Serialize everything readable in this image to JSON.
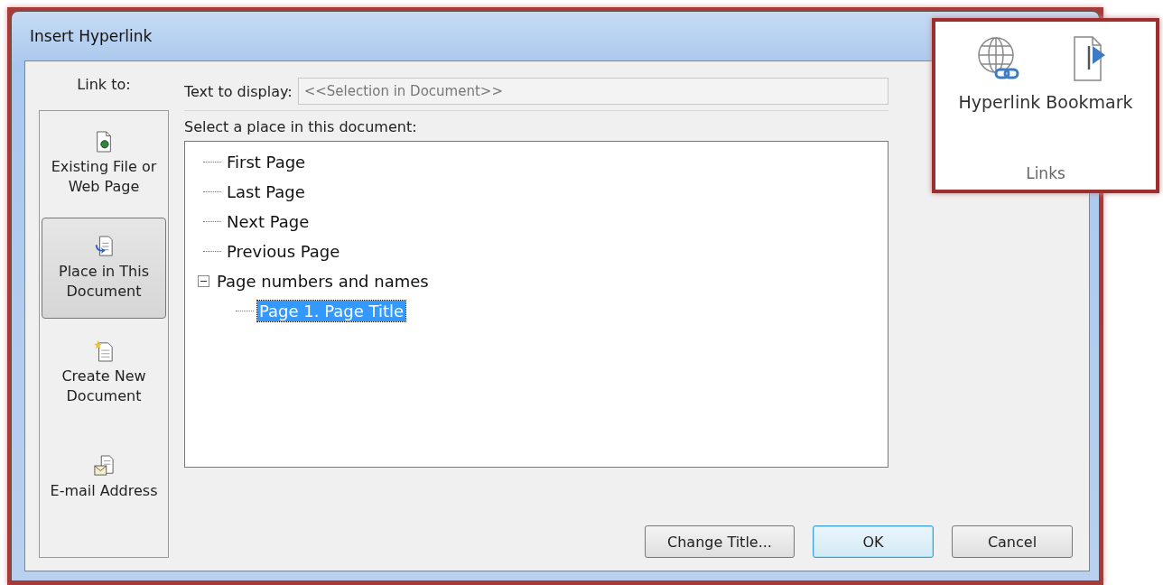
{
  "window": {
    "title": "Insert Hyperlink"
  },
  "link_to": {
    "label": "Link to:",
    "items": [
      {
        "kind": "file",
        "label": "Existing File or Web Page",
        "selected": false
      },
      {
        "kind": "place",
        "label": "Place in This Document",
        "selected": true
      },
      {
        "kind": "new",
        "label": "Create New Document",
        "selected": false
      },
      {
        "kind": "email",
        "label": "E-mail Address",
        "selected": false
      }
    ]
  },
  "text_to_display": {
    "label": "Text to display:",
    "value": "<<Selection in Document>>"
  },
  "place_tree": {
    "label": "Select a place in this document:",
    "items": [
      {
        "label": "First Page",
        "selected": false
      },
      {
        "label": "Last Page",
        "selected": false
      },
      {
        "label": "Next Page",
        "selected": false
      },
      {
        "label": "Previous Page",
        "selected": false
      },
      {
        "label": "Page numbers and names",
        "selected": false,
        "expanded": true,
        "children": [
          {
            "label": "Page 1. Page Title",
            "selected": true
          }
        ]
      }
    ]
  },
  "buttons": [
    {
      "label": "Change Title...",
      "default": false
    },
    {
      "label": "OK",
      "default": true
    },
    {
      "label": "Cancel",
      "default": false
    }
  ],
  "ribbon_group": {
    "title": "Links",
    "buttons": [
      {
        "kind": "hyperlink",
        "label": "Hyperlink"
      },
      {
        "kind": "bookmark",
        "label": "Bookmark"
      }
    ]
  }
}
